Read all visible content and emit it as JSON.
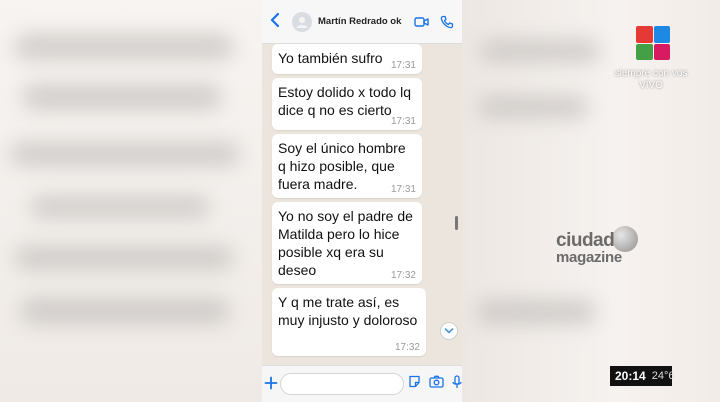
{
  "chat": {
    "contact_name": "Martín Redrado ok",
    "input_placeholder": "",
    "messages": [
      {
        "text": "Yo también sufro",
        "time": "17:31"
      },
      {
        "text": "Estoy dolido x todo lq dice q no es cierto",
        "time": "17:31"
      },
      {
        "text": "Soy el único hombre q hizo posible, que fuera madre.",
        "time": "17:31"
      },
      {
        "text": "Yo no soy el padre de Matilda pero lo hice posible xq era su deseo",
        "time": "17:32"
      },
      {
        "text": "Y q me trate así, es muy injusto y doloroso",
        "time": "17:32"
      }
    ]
  },
  "broadcast": {
    "tagline_line1": "siempre con vos",
    "tagline_line2": "VIVO",
    "magazine_line1": "ciudad",
    "magazine_line2": "magazine",
    "clock": "20:14",
    "temperature": "24°6"
  },
  "icons": {
    "back": "back-chevron-icon",
    "video": "video-call-icon",
    "phone": "phone-call-icon",
    "plus": "plus-icon",
    "sticker": "sticker-icon",
    "camera": "camera-icon",
    "mic": "microphone-icon",
    "scroll": "scroll-down-icon"
  },
  "colors": {
    "accent": "#1a73e8",
    "chat_background": "#ece5dd",
    "bubble": "#ffffff",
    "logo_red": "#e53935",
    "logo_blue": "#1e88e5",
    "logo_green": "#43a047",
    "logo_magenta": "#d81b60"
  }
}
